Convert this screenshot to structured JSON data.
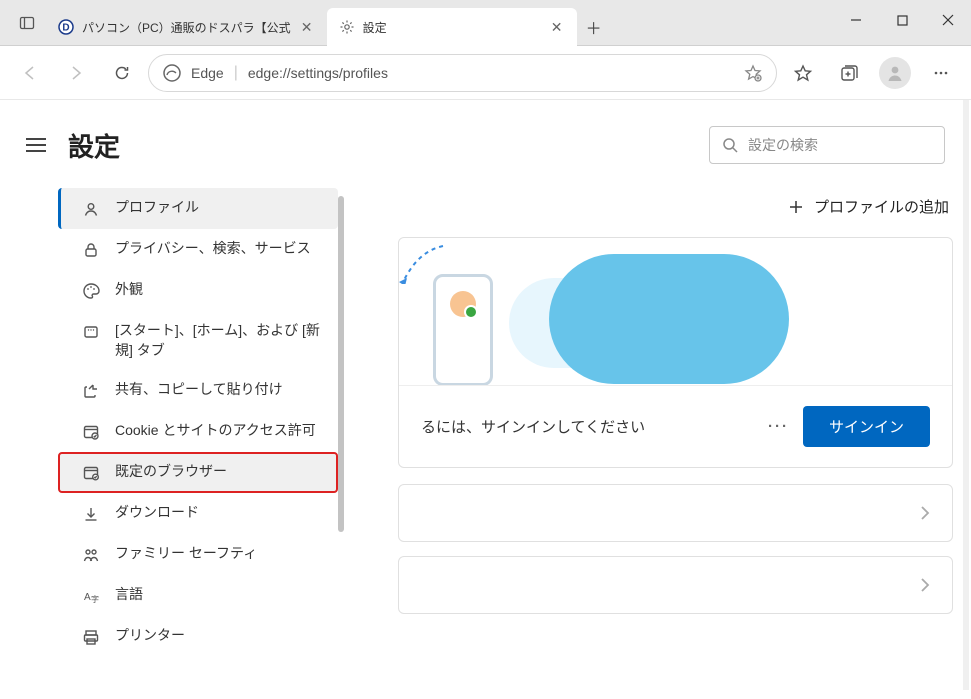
{
  "window": {
    "tabs": [
      {
        "title": "パソコン（PC）通販のドスパラ【公式",
        "active": false
      },
      {
        "title": "設定",
        "active": true
      }
    ]
  },
  "toolbar": {
    "name": "Edge",
    "url": "edge://settings/profiles"
  },
  "page": {
    "title": "設定",
    "search_placeholder": "設定の検索",
    "add_profile": "プロファイルの追加",
    "signin_prompt": "るには、サインインしてください",
    "signin_button": "サインイン"
  },
  "sidebar": {
    "items": [
      {
        "label": "プロファイル",
        "icon": "profile",
        "active": true
      },
      {
        "label": "プライバシー、検索、サービス",
        "icon": "lock"
      },
      {
        "label": "外観",
        "icon": "palette"
      },
      {
        "label": "[スタート]、[ホーム]、および [新規] タブ",
        "icon": "power"
      },
      {
        "label": "共有、コピーして貼り付け",
        "icon": "share"
      },
      {
        "label": "Cookie とサイトのアクセス許可",
        "icon": "cookie"
      },
      {
        "label": "既定のブラウザー",
        "icon": "browser",
        "highlight": true,
        "hover": true
      },
      {
        "label": "ダウンロード",
        "icon": "download"
      },
      {
        "label": "ファミリー セーフティ",
        "icon": "family"
      },
      {
        "label": "言語",
        "icon": "language"
      },
      {
        "label": "プリンター",
        "icon": "printer"
      }
    ]
  }
}
